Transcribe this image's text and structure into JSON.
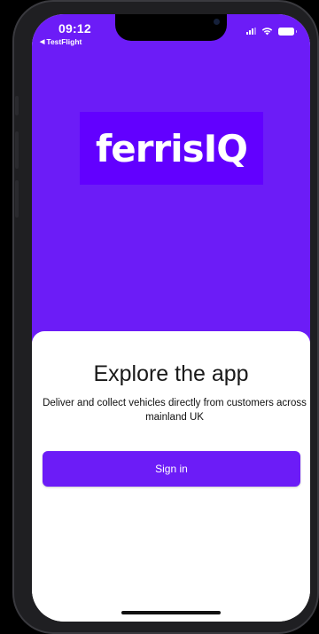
{
  "status_bar": {
    "time": "09:12",
    "back_app": "TestFlight",
    "back_icon": "back-triangle-icon",
    "icons": [
      "cellular-signal-icon",
      "wifi-icon",
      "battery-icon"
    ]
  },
  "brand": {
    "logo_text": "ferrisIQ"
  },
  "sheet": {
    "title": "Explore the app",
    "description": "Deliver and collect vehicles directly from customers across mainland UK",
    "signin_label": "Sign in"
  },
  "colors": {
    "hero_background": "#6c1cf7",
    "logo_background": "#6200ff",
    "button_background": "#6c1cf7",
    "sheet_background": "#ffffff"
  }
}
